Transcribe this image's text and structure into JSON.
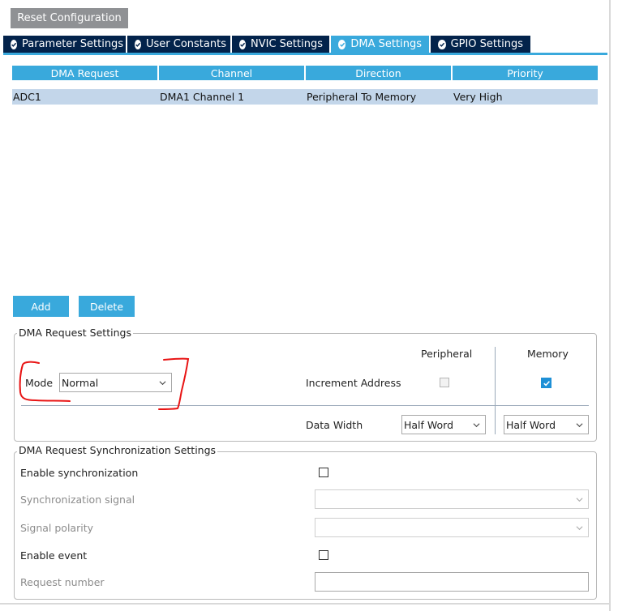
{
  "toolbar": {
    "reset_label": "Reset Configuration"
  },
  "tabs": [
    {
      "label": "Parameter Settings",
      "active": false
    },
    {
      "label": "User Constants",
      "active": false
    },
    {
      "label": "NVIC Settings",
      "active": false
    },
    {
      "label": "DMA Settings",
      "active": true
    },
    {
      "label": "GPIO Settings",
      "active": false
    }
  ],
  "dma_table": {
    "columns": [
      "DMA Request",
      "Channel",
      "Direction",
      "Priority"
    ],
    "rows": [
      {
        "request": "ADC1",
        "channel": "DMA1 Channel 1",
        "direction": "Peripheral To Memory",
        "priority": "Very High"
      }
    ]
  },
  "actions": {
    "add_label": "Add",
    "delete_label": "Delete"
  },
  "request_settings": {
    "title": "DMA Request Settings",
    "mode_label": "Mode",
    "mode_value": "Normal",
    "peripheral_header": "Peripheral",
    "memory_header": "Memory",
    "increment_label": "Increment Address",
    "increment_peripheral": false,
    "increment_memory": true,
    "data_width_label": "Data Width",
    "peripheral_width": "Half Word",
    "memory_width": "Half Word"
  },
  "sync_settings": {
    "title": "DMA Request Synchronization Settings",
    "enable_sync_label": "Enable synchronization",
    "sync_signal_label": "Synchronization signal",
    "signal_polarity_label": "Signal polarity",
    "enable_event_label": "Enable event",
    "request_number_label": "Request number"
  },
  "annotation": {
    "color": "#e81414"
  },
  "colors": {
    "accent": "#39a9dc",
    "tab_dark": "#03234b",
    "row_selected": "#c3d6ea",
    "reset_button": "#8f9194"
  }
}
